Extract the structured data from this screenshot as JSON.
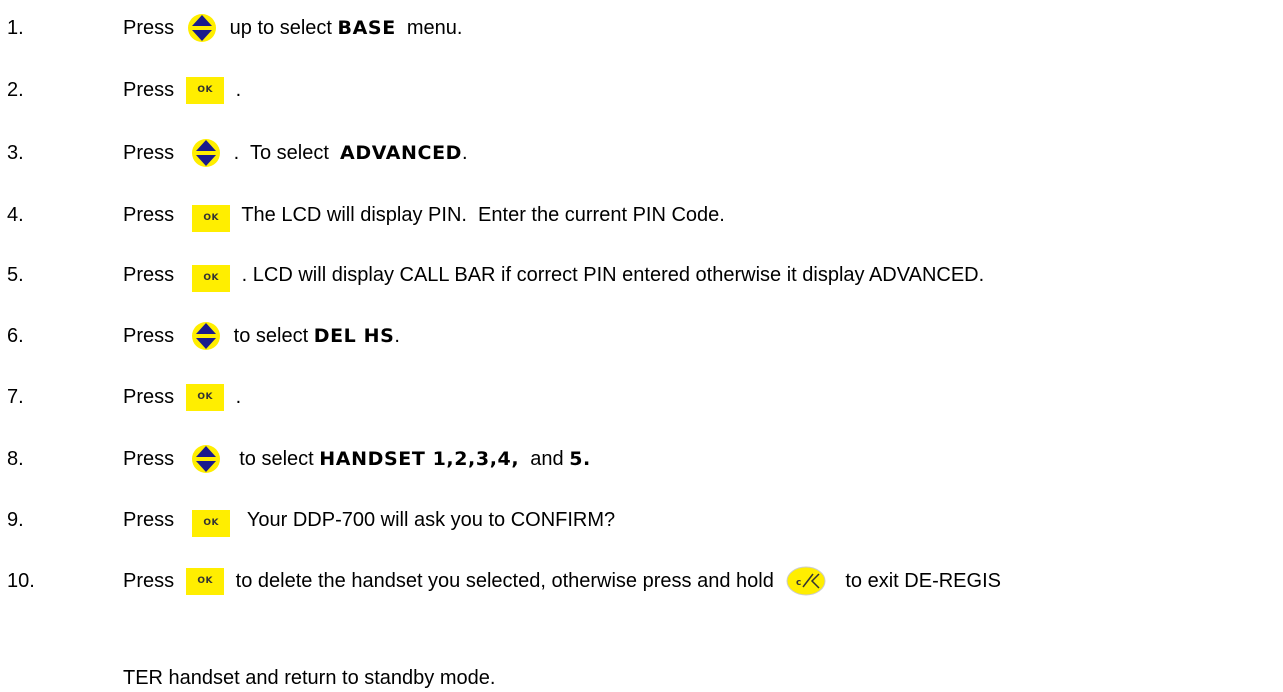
{
  "steps": [
    {
      "num": "1.",
      "press": "Press",
      "t1": " up to select ",
      "b1": "BASE",
      "t2": "  menu."
    },
    {
      "num": "2.",
      "press": "Press",
      "t1": " ."
    },
    {
      "num": "3.",
      "press": "Press",
      "t1": " .  To select  ",
      "b1": "ADVANCED",
      "t2": "."
    },
    {
      "num": "4.",
      "press": "Press",
      "t1": " The LCD will display PIN.  Enter the current PIN Code."
    },
    {
      "num": "5.",
      "press": "Press",
      "t1": " . LCD will display CALL BAR if correct PIN entered otherwise it display ADVANCED."
    },
    {
      "num": "6.",
      "press": "Press",
      "t1": " to select ",
      "b1": "DEL HS",
      "t2": "."
    },
    {
      "num": "7.",
      "press": "Press",
      "t1": " ."
    },
    {
      "num": "8.",
      "press": "Press",
      "t1": "  to select ",
      "b1": "HANDSET 1,2,3,4,",
      "t2": "  and ",
      "b2": "5."
    },
    {
      "num": "9.",
      "press": "Press",
      "t1": "  Your DDP-700 will ask you to CONFIRM?"
    },
    {
      "num": "10.",
      "press": "Press",
      "t1": " to delete the handset you selected, otherwise press and hold ",
      "t2": "to exit DE-REGIS"
    }
  ],
  "continuation": "TER  handset and return to standby mode.",
  "icons": {
    "ok_label": "OK",
    "cancel_label": "c"
  },
  "colors": {
    "button_yellow": "#ffee00",
    "arrow_blue": "#1a1a8c"
  }
}
